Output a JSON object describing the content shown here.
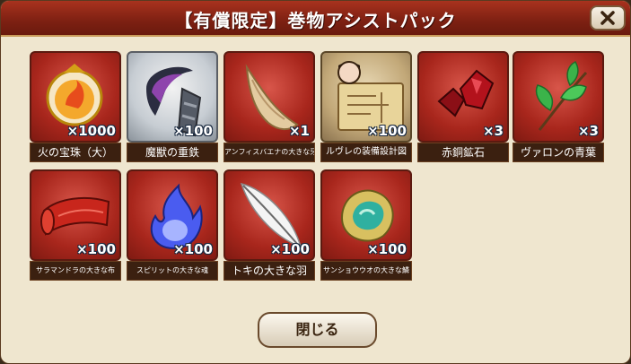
{
  "dialog": {
    "title": "【有償限定】巻物アシストパック",
    "close_button_label": "閉じる"
  },
  "items": [
    {
      "name": "火の宝珠（大）",
      "qty": "×1000",
      "icon": "fire-orb-icon"
    },
    {
      "name": "魔獣の重鉄",
      "qty": "×100",
      "icon": "beast-iron-icon"
    },
    {
      "name": "アンフィスバエナの大きな牙",
      "qty": "×1",
      "icon": "fang-icon"
    },
    {
      "name": "ルヴレの装備設計図",
      "qty": "×100",
      "icon": "blueprint-icon"
    },
    {
      "name": "赤銅鉱石",
      "qty": "×3",
      "icon": "copper-ore-icon"
    },
    {
      "name": "ヴァロンの青葉",
      "qty": "×3",
      "icon": "leaf-icon"
    },
    {
      "name": "サラマンドラの大きな布",
      "qty": "×100",
      "icon": "cloth-icon"
    },
    {
      "name": "スピリットの大きな魂",
      "qty": "×100",
      "icon": "spirit-soul-icon"
    },
    {
      "name": "トキの大きな羽",
      "qty": "×100",
      "icon": "feather-icon"
    },
    {
      "name": "サンショウウオの大きな鱗",
      "qty": "×100",
      "icon": "scale-icon"
    }
  ]
}
